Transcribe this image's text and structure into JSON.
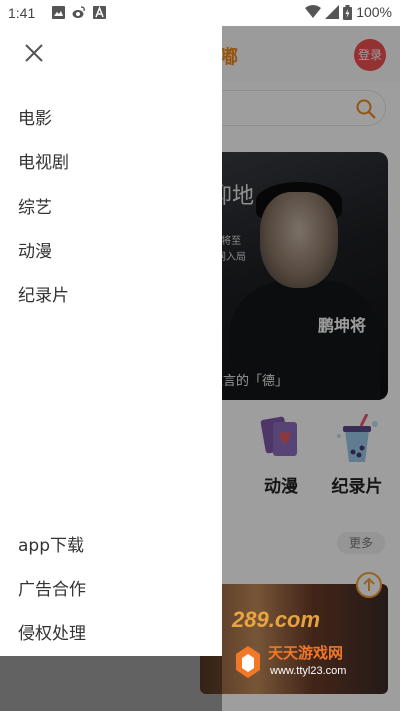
{
  "status_bar": {
    "time": "1:41",
    "battery": "100%",
    "icons": [
      "image-icon",
      "weibo-icon",
      "font-icon",
      "wifi-icon",
      "signal-icon",
      "battery-icon"
    ]
  },
  "app": {
    "logo": "嘟嘟",
    "login_label": "登录",
    "categories": [
      {
        "label": "动漫",
        "icon": "cards-icon"
      },
      {
        "label": "纪录片",
        "icon": "bubble-tea-icon"
      }
    ],
    "more_label": "更多",
    "banner_text": {
      "t1": "仰地",
      "t2": "把”将至",
      "t3": "全网入局",
      "t4": "鹏坤将",
      "t5": "推言的「德」"
    }
  },
  "drawer": {
    "top_items": [
      "电影",
      "电视剧",
      "综艺",
      "动漫",
      "纪录片"
    ],
    "bottom_items": [
      "app下载",
      "广告合作",
      "侵权处理"
    ]
  },
  "watermark": {
    "brand": "天天游戏网",
    "url": "www.ttyl23.com",
    "logo_text": "289.com"
  },
  "colors": {
    "accent_orange": "#f08a1a",
    "login_red": "#ef4f4f"
  }
}
